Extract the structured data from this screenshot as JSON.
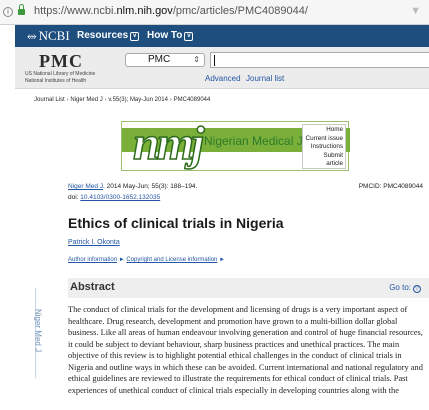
{
  "browser": {
    "url_prefix": "https://www.ncbi.",
    "url_domain": "nlm.nih.gov",
    "url_path": "/pmc/articles/PMC4089044/",
    "info_glyph": "i"
  },
  "ncbi_bar": {
    "logo": "NCBI",
    "resources": "Resources",
    "howto": "How To"
  },
  "pmc_header": {
    "logo": "PMC",
    "nlm_line1": "US National Library of Medicine",
    "nlm_line2": "National Institutes of Health",
    "database_selected": "PMC",
    "search_value": "",
    "advanced": "Advanced",
    "journal_list": "Journal list"
  },
  "breadcrumb": {
    "items": [
      "Journal List",
      "Niger Med J",
      "v.55(3); May-Jun 2014",
      "PMC4089044"
    ],
    "separator": "›"
  },
  "banner": {
    "logo_text": "nmj",
    "journal_name": "Nigerian Medical Journal",
    "links": [
      "Home",
      "Current issue",
      "Instructions",
      "Submit article"
    ]
  },
  "vertical_label": "Niger Med J",
  "citation": {
    "journal": "Niger Med J",
    "details": ". 2014 May-Jun; 55(3): 188–194.",
    "doi_label": "doi:",
    "doi": "10.4103/0300-1652.132035",
    "pmcid": "PMCID: PMC4089044"
  },
  "article": {
    "title": "Ethics of clinical trials in Nigeria",
    "author": "Patrick I. Okonta",
    "author_info": "Author information",
    "copyright_info": "Copyright and License information",
    "arrow": "►"
  },
  "abstract": {
    "heading": "Abstract",
    "goto": "Go to:",
    "goto_icon": "▽",
    "text": "The conduct of clinical trials for the development and licensing of drugs is a very important aspect of healthcare. Drug research, development and promotion have grown to a multi-billion dollar global business. Like all areas of human endeavour involving generation and control of huge financial resources, it could be subject to deviant behaviour, sharp business practices and unethical practices. The main objective of this review is to highlight potential ethical challenges in the conduct of clinical trials in Nigeria and outline ways in which these can be avoided. Current international and national regulatory and ethical guidelines are reviewed to illustrate the requirements for ethical conduct of clinical trials. Past experiences of unethical conduct of clinical trials especially in developing countries along with the"
  },
  "colors": {
    "ncbi_bar": "#1d4e7e",
    "link": "#2356a5",
    "banner_green": "#7ab03a",
    "journal_green": "#2d7a2a"
  }
}
